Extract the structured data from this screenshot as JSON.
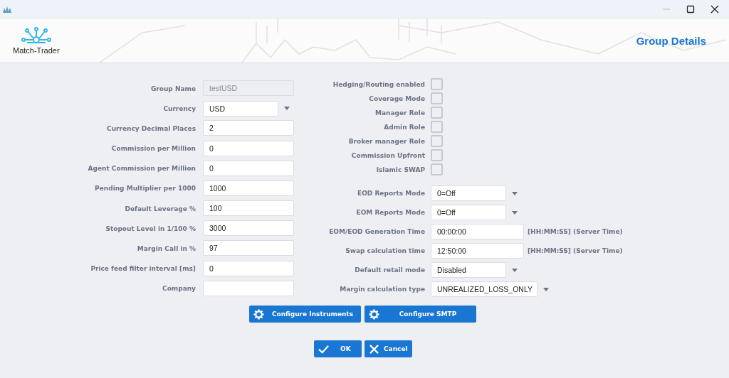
{
  "header": {
    "logo_text": "Match-Trader",
    "title": "Group Details"
  },
  "left_fields": [
    {
      "label": "Group Name",
      "kind": "text",
      "value": "testUSD",
      "disabled": true
    },
    {
      "label": "Currency",
      "kind": "select",
      "value": "USD",
      "disabled": false
    },
    {
      "label": "Currency Decimal Places",
      "kind": "text",
      "value": "2",
      "disabled": false
    },
    {
      "label": "Commission per Million",
      "kind": "text",
      "value": "0",
      "disabled": false
    },
    {
      "label": "Agent Commission per Million",
      "kind": "text",
      "value": "0",
      "disabled": false
    },
    {
      "label": "Pending Multiplier per 1000",
      "kind": "text",
      "value": "1000",
      "disabled": false
    },
    {
      "label": "Default Leverage %",
      "kind": "text",
      "value": "100",
      "disabled": false
    },
    {
      "label": "Stopout Level in 1/100 %",
      "kind": "text",
      "value": "3000",
      "disabled": false
    },
    {
      "label": "Margin Call in %",
      "kind": "text",
      "value": "97",
      "disabled": false
    },
    {
      "label": "Price feed filter interval [ms]",
      "kind": "text",
      "value": "0",
      "disabled": false
    },
    {
      "label": "Company",
      "kind": "text",
      "disabled": false
    }
  ],
  "checkboxes": [
    {
      "label": "Hedging/Routing enabled",
      "checked": false
    },
    {
      "label": "Coverage Mode",
      "checked": false
    },
    {
      "label": "Manager Role",
      "checked": false
    },
    {
      "label": "Admin Role",
      "checked": false
    },
    {
      "label": "Broker manager Role",
      "checked": false
    },
    {
      "label": "Commission Upfront",
      "checked": false
    },
    {
      "label": "Islamic SWAP",
      "checked": false
    }
  ],
  "right_fields": [
    {
      "label": "EOD Reports Mode",
      "kind": "select",
      "value": "0=Off"
    },
    {
      "label": "EOM Reports Mode",
      "kind": "select",
      "value": "0=Off"
    },
    {
      "label": "EOM/EOD Generation Time",
      "kind": "text",
      "value": "00:00:00",
      "suffix": "[HH:MM:SS] (Server Time)"
    },
    {
      "label": "Swap calculation time",
      "kind": "text",
      "value": "12:50:00",
      "suffix": "[HH:MM:SS] (Server Time)"
    },
    {
      "label": "Default retail mode",
      "kind": "select",
      "value": "Disabled"
    },
    {
      "label": "Margin calculation type",
      "kind": "wideselect",
      "value": "UNREALIZED_LOSS_ONLY"
    }
  ],
  "config_buttons": [
    "Configure Instruments",
    "Configure SMTP"
  ],
  "dialog_buttons": [
    {
      "label": "OK",
      "kind": "ok"
    },
    {
      "label": "Cancel",
      "kind": "cancel"
    }
  ]
}
